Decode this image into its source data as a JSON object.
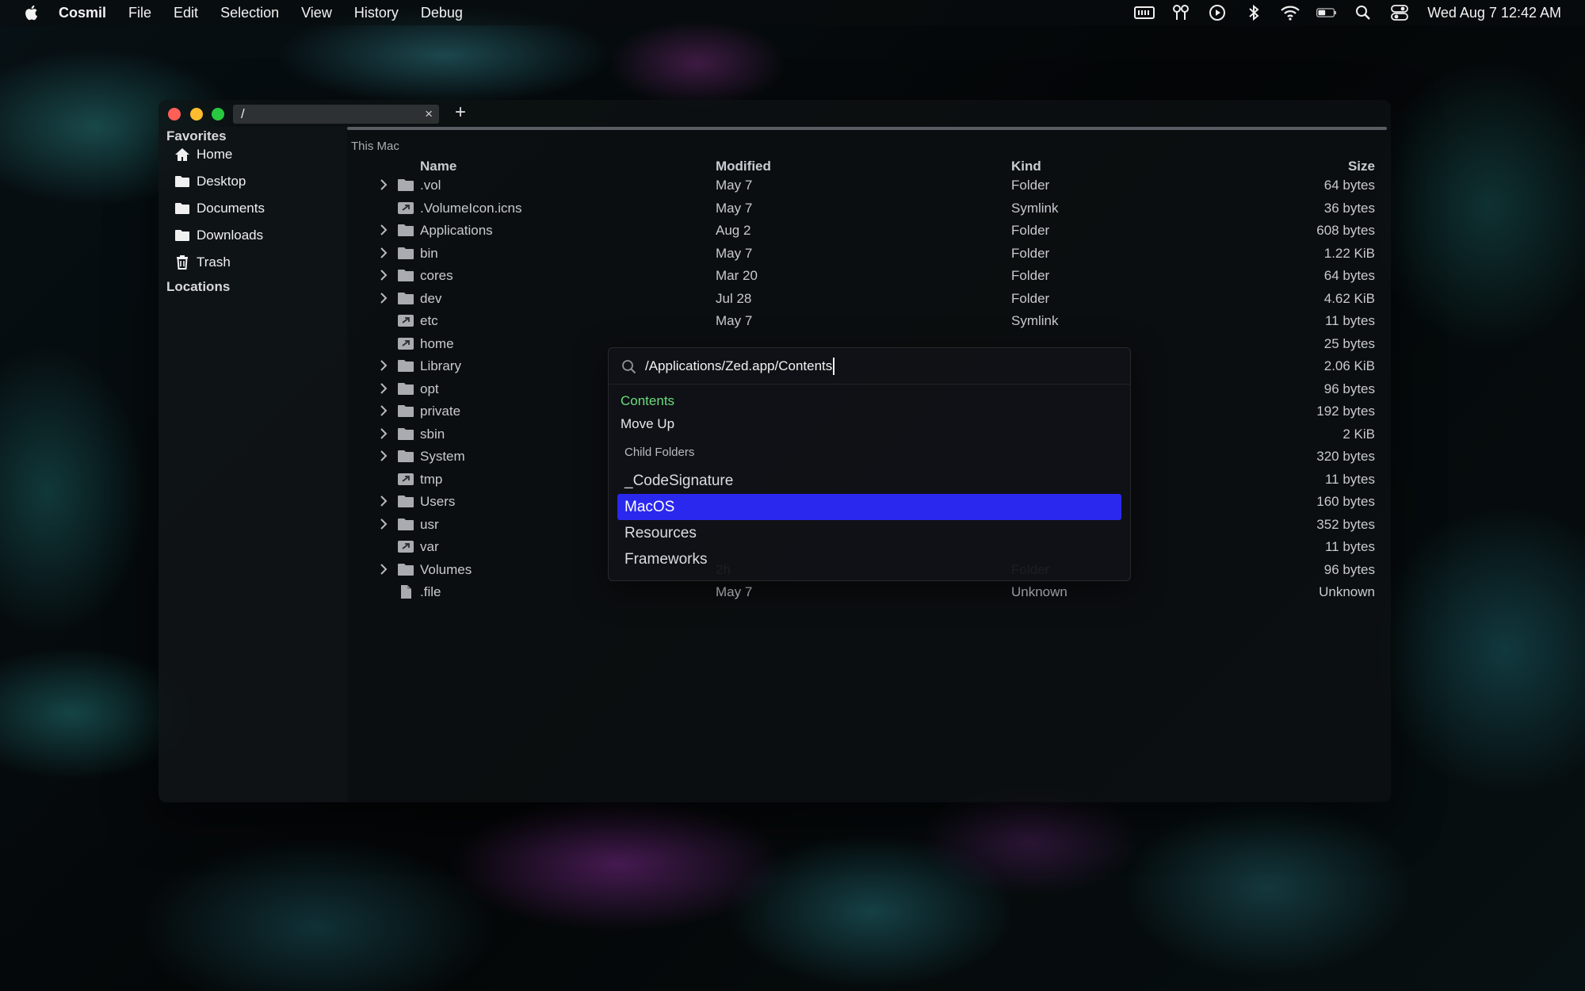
{
  "menubar": {
    "app_name": "Cosmil",
    "menus": [
      "File",
      "Edit",
      "Selection",
      "View",
      "History",
      "Debug"
    ],
    "clock": "Wed Aug 7  12:42 AM",
    "tray_icons": [
      "memory-icon",
      "airpods-icon",
      "play-icon",
      "bluetooth-icon",
      "wifi-icon",
      "battery-icon",
      "spotlight-search-icon",
      "control-center-icon"
    ]
  },
  "window": {
    "tab": {
      "title": "/",
      "close_label": "×"
    },
    "new_tab_label": "+"
  },
  "sidebar": {
    "favorites_title": "Favorites",
    "favorites": [
      {
        "label": "Home",
        "icon": "home-icon"
      },
      {
        "label": "Desktop",
        "icon": "folder-icon"
      },
      {
        "label": "Documents",
        "icon": "folder-icon"
      },
      {
        "label": "Downloads",
        "icon": "folder-icon"
      },
      {
        "label": "Trash",
        "icon": "trash-icon"
      }
    ],
    "locations_title": "Locations"
  },
  "main": {
    "location_label": "This Mac",
    "columns": {
      "name": "Name",
      "modified": "Modified",
      "kind": "Kind",
      "size": "Size"
    },
    "rows": [
      {
        "name": ".vol",
        "modified": "May 7",
        "kind": "Folder",
        "size": "64 bytes",
        "type": "folder",
        "expandable": true
      },
      {
        "name": ".VolumeIcon.icns",
        "modified": "May 7",
        "kind": "Symlink",
        "size": "36 bytes",
        "type": "symlink",
        "expandable": false
      },
      {
        "name": "Applications",
        "modified": "Aug 2",
        "kind": "Folder",
        "size": "608 bytes",
        "type": "folder",
        "expandable": true
      },
      {
        "name": "bin",
        "modified": "May 7",
        "kind": "Folder",
        "size": "1.22 KiB",
        "type": "folder",
        "expandable": true
      },
      {
        "name": "cores",
        "modified": "Mar 20",
        "kind": "Folder",
        "size": "64 bytes",
        "type": "folder",
        "expandable": true
      },
      {
        "name": "dev",
        "modified": "Jul 28",
        "kind": "Folder",
        "size": "4.62 KiB",
        "type": "folder",
        "expandable": true
      },
      {
        "name": "etc",
        "modified": "May 7",
        "kind": "Symlink",
        "size": "11 bytes",
        "type": "symlink",
        "expandable": false
      },
      {
        "name": "home",
        "modified": "",
        "kind": "",
        "size": "25 bytes",
        "type": "symlink",
        "expandable": false
      },
      {
        "name": "Library",
        "modified": "",
        "kind": "",
        "size": "2.06 KiB",
        "type": "folder",
        "expandable": true
      },
      {
        "name": "opt",
        "modified": "",
        "kind": "",
        "size": "96 bytes",
        "type": "folder",
        "expandable": true
      },
      {
        "name": "private",
        "modified": "",
        "kind": "",
        "size": "192 bytes",
        "type": "folder",
        "expandable": true
      },
      {
        "name": "sbin",
        "modified": "",
        "kind": "",
        "size": "2 KiB",
        "type": "folder",
        "expandable": true
      },
      {
        "name": "System",
        "modified": "",
        "kind": "",
        "size": "320 bytes",
        "type": "folder",
        "expandable": true
      },
      {
        "name": "tmp",
        "modified": "",
        "kind": "",
        "size": "11 bytes",
        "type": "symlink",
        "expandable": false
      },
      {
        "name": "Users",
        "modified": "",
        "kind": "",
        "size": "160 bytes",
        "type": "folder",
        "expandable": true
      },
      {
        "name": "usr",
        "modified": "",
        "kind": "",
        "size": "352 bytes",
        "type": "folder",
        "expandable": true
      },
      {
        "name": "var",
        "modified": "",
        "kind": "",
        "size": "11 bytes",
        "type": "symlink",
        "expandable": false
      },
      {
        "name": "Volumes",
        "modified": "2h",
        "kind": "Folder",
        "size": "96 bytes",
        "type": "folder",
        "expandable": true
      },
      {
        "name": ".file",
        "modified": "May 7",
        "kind": "Unknown",
        "size": "Unknown",
        "type": "file",
        "expandable": false
      }
    ]
  },
  "palette": {
    "query": "/Applications/Zed.app/Contents",
    "current_folder": "Contents",
    "move_up_label": "Move Up",
    "group_label": "Child Folders",
    "options": [
      "_CodeSignature",
      "MacOS",
      "Resources",
      "Frameworks"
    ],
    "selected_index": 1
  },
  "colors": {
    "selection": "#2a28ee",
    "current_folder": "#6ddc7c",
    "close": "#ff5f57",
    "minimize": "#febc2e",
    "maximize": "#28c840"
  }
}
